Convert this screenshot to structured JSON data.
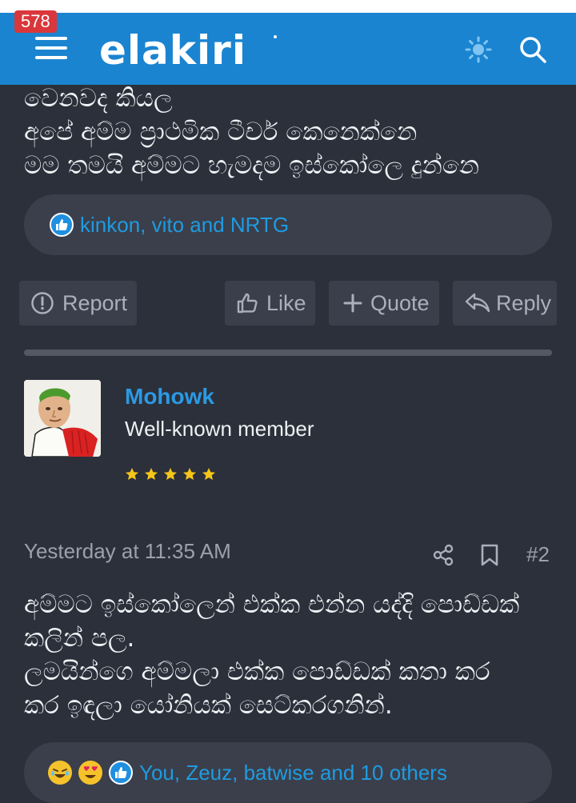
{
  "header": {
    "notification_count": "578",
    "logo_text": "elakiri"
  },
  "post1": {
    "text_lines": [
      "වෙනවද කියල",
      "අපේ අම්ම ප්‍රාථමික ටීචර් කෙනෙක්නෙ",
      "මම තමයි අම්මට හැමදම ඉස්කෝලෙ දුන්නෙ"
    ],
    "reactions_text": "kinkon, vito and NRTG",
    "actions": {
      "report": "Report",
      "like": "Like",
      "quote": "Quote",
      "reply": "Reply"
    }
  },
  "post2": {
    "username": "Mohowk",
    "user_title": "Well-known member",
    "star_count": 5,
    "timestamp": "Yesterday at 11:35 AM",
    "post_number": "#2",
    "text_lines": [
      "අම්මට ඉස්කෝලෙන් එක්ක එන්න යද්දි පොඩ්ඩක්",
      "කලින් පල.",
      "ලමයින්ගෙ අම්මලා එක්ක පොඩ්ඩක් කතා කර",
      "කර ඉඳලා යෝනියක් සෙට්කරගනින්."
    ],
    "reactions_text": "You, Zeuz, batwise and 10 others"
  },
  "colors": {
    "header_bg": "#1a84d0",
    "page_bg": "#2c303b",
    "link": "#2b9ae3",
    "badge": "#d9373b",
    "star": "#f5c518"
  },
  "icons": [
    "hamburger-icon",
    "theme-toggle-icon",
    "search-icon",
    "like-badge-icon",
    "report-icon",
    "thumbs-up-icon",
    "plus-icon",
    "reply-icon",
    "star-icon",
    "share-icon",
    "bookmark-icon",
    "laughing-emoji-icon",
    "heart-eyes-emoji-icon"
  ]
}
